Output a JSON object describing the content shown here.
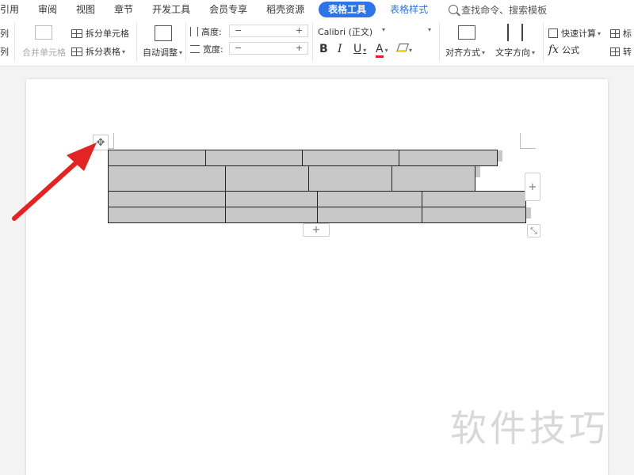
{
  "tabs": [
    {
      "label": "引用"
    },
    {
      "label": "审阅"
    },
    {
      "label": "视图"
    },
    {
      "label": "章节"
    },
    {
      "label": "开发工具"
    },
    {
      "label": "会员专享"
    },
    {
      "label": "稻壳资源"
    }
  ],
  "active_tab": "表格工具",
  "alt_tab": "表格样式",
  "search_placeholder": "查找命令、搜索模板",
  "ribbon": {
    "col_top": "列",
    "col_bottom": "列",
    "merge_cells": "合并单元格",
    "split_cells": "拆分单元格",
    "split_table": "拆分表格",
    "auto_adjust": "自动调整",
    "height_label": "高度:",
    "width_label": "宽度:",
    "minus": "−",
    "plus": "+",
    "font_name": "Calibri (正文)",
    "bold": "B",
    "italic": "I",
    "underline": "U",
    "font_color": "A",
    "align": "对齐方式",
    "text_direction": "文字方向",
    "quick_calc": "快速计算",
    "formula": "公式",
    "fx": "fx",
    "label_cut1": "标",
    "label_cut2": "转",
    "font_color_hex": "#e02020",
    "highlight_hex": "#f5d90a"
  },
  "doc": {
    "move_handle": "✥",
    "add_row": "+",
    "add_col": "+",
    "resize": "⤡"
  },
  "watermark": "软件技巧"
}
